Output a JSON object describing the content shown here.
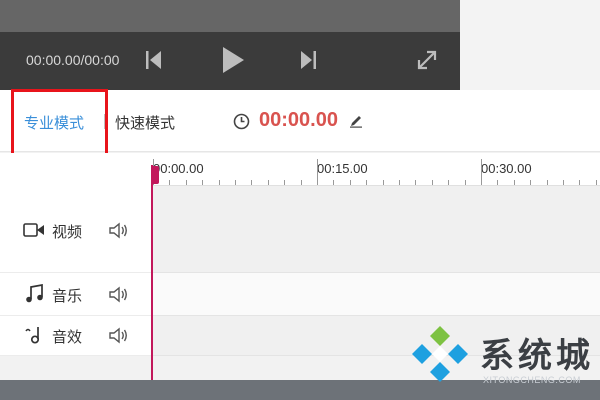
{
  "player": {
    "time_display": "00:00.00/00:00",
    "icons": {
      "prev": "skip-previous-icon",
      "play": "play-icon",
      "next": "skip-next-icon",
      "fullscreen": "fullscreen-icon"
    }
  },
  "toolbar": {
    "mode_pro": "专业模式",
    "mode_fast": "快速模式",
    "timer": "00:00.00",
    "icons": {
      "clock": "clock-icon",
      "edit": "pencil-icon"
    }
  },
  "ruler": {
    "ticks": [
      "00:00.00",
      "00:15.00",
      "00:30.00"
    ]
  },
  "tracks": [
    {
      "name": "视频",
      "icon": "video-camera-icon"
    },
    {
      "name": "音乐",
      "icon": "music-note-icon"
    },
    {
      "name": "音效",
      "icon": "sound-effect-icon"
    }
  ],
  "watermark": {
    "text": "系统城",
    "sub": "XITONGCHENG.COM"
  },
  "colors": {
    "accent": "#3a8fd9",
    "timer": "#d9534f",
    "playhead": "#c2185b",
    "highlight": "#e8141b"
  }
}
